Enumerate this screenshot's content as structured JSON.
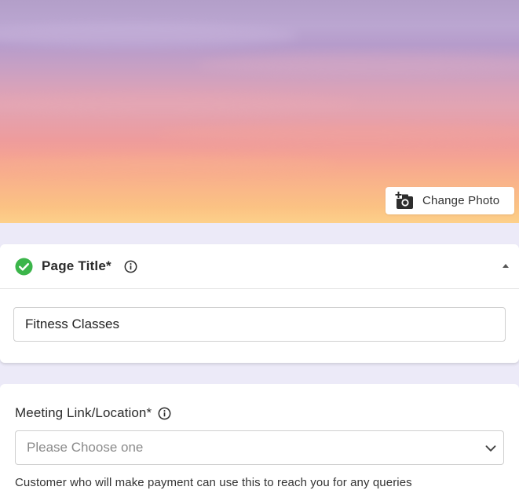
{
  "banner": {
    "change_photo_label": "Change Photo",
    "icon": "add-photo-icon"
  },
  "page_title_section": {
    "status_icon": "check-circle-icon",
    "status_color": "#3BB54A",
    "title": "Page Title*",
    "info_icon": "info-icon",
    "collapse_icon": "caret-up-icon",
    "input_value": "Fitness Classes"
  },
  "meeting_section": {
    "label": "Meeting Link/Location*",
    "info_icon": "info-icon",
    "select_placeholder": "Please Choose one",
    "select_icon": "chevron-down-icon",
    "helper_text": "Customer who will make payment can use this to reach you for any queries"
  }
}
